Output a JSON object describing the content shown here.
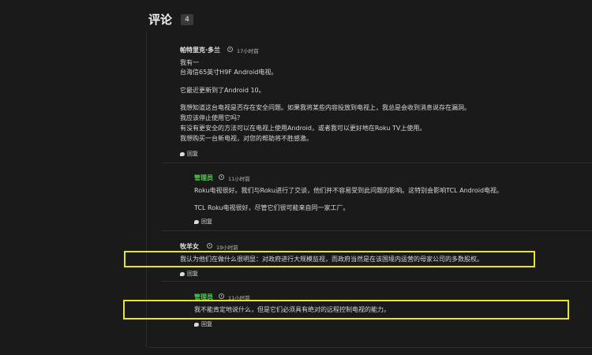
{
  "header": {
    "title": "评论",
    "count": "4"
  },
  "comments": [
    {
      "author": "帕特里克·多兰",
      "time": "17小时前",
      "lines": [
        "我有一",
        "台海信65英寸H9F Android电视。",
        "它最近更新到了Android 10。",
        "我想知道这台电视是否存在安全问题。如果我将某些内容投放到电视上，我总是会收到消息说存在漏洞。",
        "我应该停止使用它吗？",
        "有没有更安全的方法可以在电视上使用Android，或者我可以更好地在Roku TV上使用。",
        "我想购买一台新电视，对您的帮助将不胜感激。"
      ],
      "reply": "回复"
    },
    {
      "author": "管理员",
      "time": "11小时前",
      "lines": [
        "Roku电视很好。我们与Roku进行了交谈，他们并不容易受到此问题的影响。这特别会影响TCL Android电视。",
        "TCL Roku电视很好，尽管它们很可能来自同一家工厂。"
      ],
      "reply": "回复"
    },
    {
      "author": "牧羊女",
      "time": "19小时前",
      "lines": [
        "我认为他们在做什么很明显：对政府进行大规模监视，而政府当然是在该国境内运营的母家公司的多数股权。"
      ],
      "reply": "回复"
    },
    {
      "author": "管理员",
      "time": "11小时前",
      "lines": [
        "我不能肯定地说什么，但是它们必须具有绝对的远程控制电视的能力。"
      ],
      "reply": "回复"
    }
  ],
  "colors": {
    "admin": "#49d34a",
    "highlight": "#e6e629",
    "background": "#1a1a1a"
  }
}
